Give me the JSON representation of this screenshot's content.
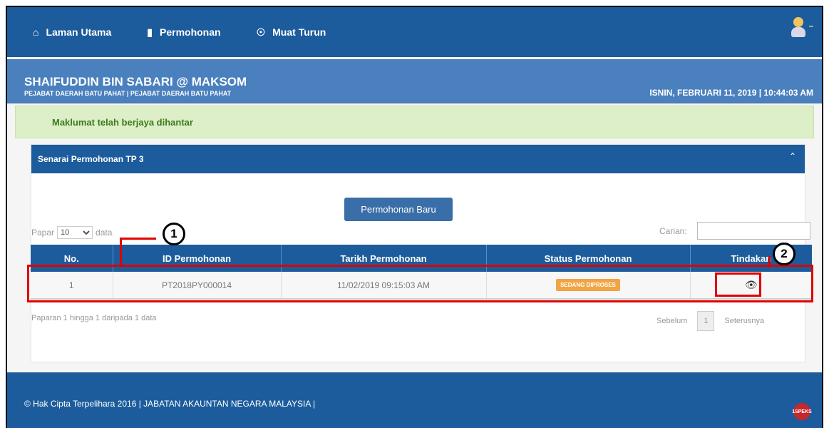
{
  "nav": {
    "items": [
      {
        "label": "Laman Utama",
        "icon": "home-icon"
      },
      {
        "label": "Permohonan",
        "icon": "book-icon"
      },
      {
        "label": "Muat Turun",
        "icon": "download-icon"
      }
    ],
    "user_icon": "user-avatar-icon"
  },
  "header": {
    "name": "SHAIFUDDIN BIN SABARI @ MAKSOM",
    "office": "PEJABAT DAERAH BATU PAHAT | PEJABAT DAERAH BATU PAHAT",
    "datetime": "ISNIN, FEBRUARI 11, 2019 | 10:44:03 AM"
  },
  "alert": {
    "message": "Maklumat telah berjaya dihantar"
  },
  "panel": {
    "title": "Senarai Permohonan TP 3",
    "new_button": "Permohonan Baru",
    "page_len_prefix": "Papar",
    "page_len_value": "10",
    "page_len_suffix": "data",
    "search_label": "Carian:",
    "search_value": ""
  },
  "table": {
    "headers": [
      "No.",
      "ID Permohonan",
      "Tarikh Permohonan",
      "Status Permohonan",
      "Tindakan"
    ],
    "rows": [
      {
        "no": "1",
        "id": "PT2018PY000014",
        "date": "11/02/2019 09:15:03 AM",
        "status": "SEDANG DIPROSES",
        "action_icon": "eye-icon"
      }
    ]
  },
  "pagination": {
    "info": "Paparan 1 hingga 1 daripada 1 data",
    "prev": "Sebelum",
    "page": "1",
    "next": "Seterusnya"
  },
  "footer": {
    "copyright": "© Hak Cipta Terpelihara 2016 | JABATAN AKAUNTAN NEGARA MALAYSIA |",
    "logo": "1SPEKS"
  },
  "annotations": {
    "marker1": "1",
    "marker2": "2"
  },
  "colors": {
    "nav": "#1c5c9c",
    "header": "#4a80be",
    "alert_bg": "#ddefc8",
    "badge": "#f0a444",
    "highlight": "#e00000"
  }
}
